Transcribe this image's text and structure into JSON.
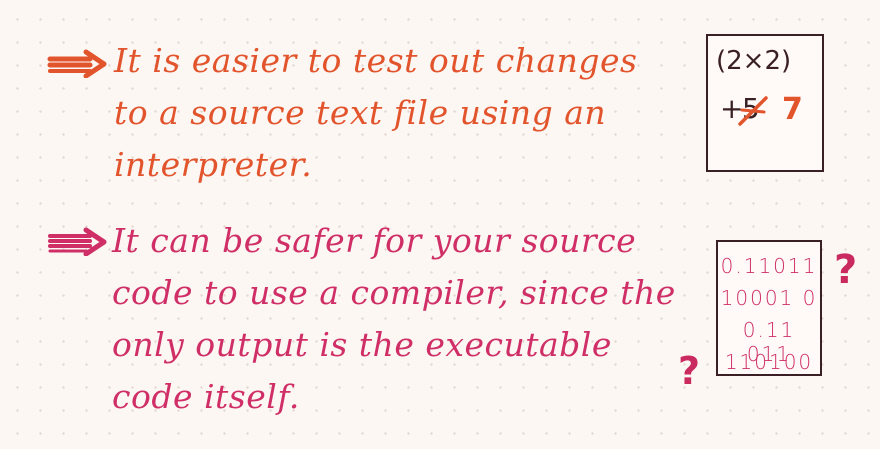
{
  "colors": {
    "orange": "#e2542c",
    "pink": "#cf2f66",
    "ink": "#3a2024",
    "paper": "#fdf7f4",
    "dot": "#e3d6d0"
  },
  "bullets": [
    {
      "icon": "arrow-right-icon",
      "lines": [
        "It is easier to test out changes",
        "to a source text file using an",
        "interpreter."
      ]
    },
    {
      "icon": "arrow-right-icon",
      "lines": [
        "It can be safer for your source",
        "code to use a compiler, since the",
        "only output is the executable",
        "code itself."
      ]
    }
  ],
  "interpreter_card": {
    "expression": "(2×2)",
    "edit_prefix": "+",
    "old_value": "5",
    "new_value": "7"
  },
  "compiler_card": {
    "rows": [
      "0.11011",
      "10001 0",
      "0.11 011",
      "110100"
    ],
    "question_mark": "?"
  }
}
